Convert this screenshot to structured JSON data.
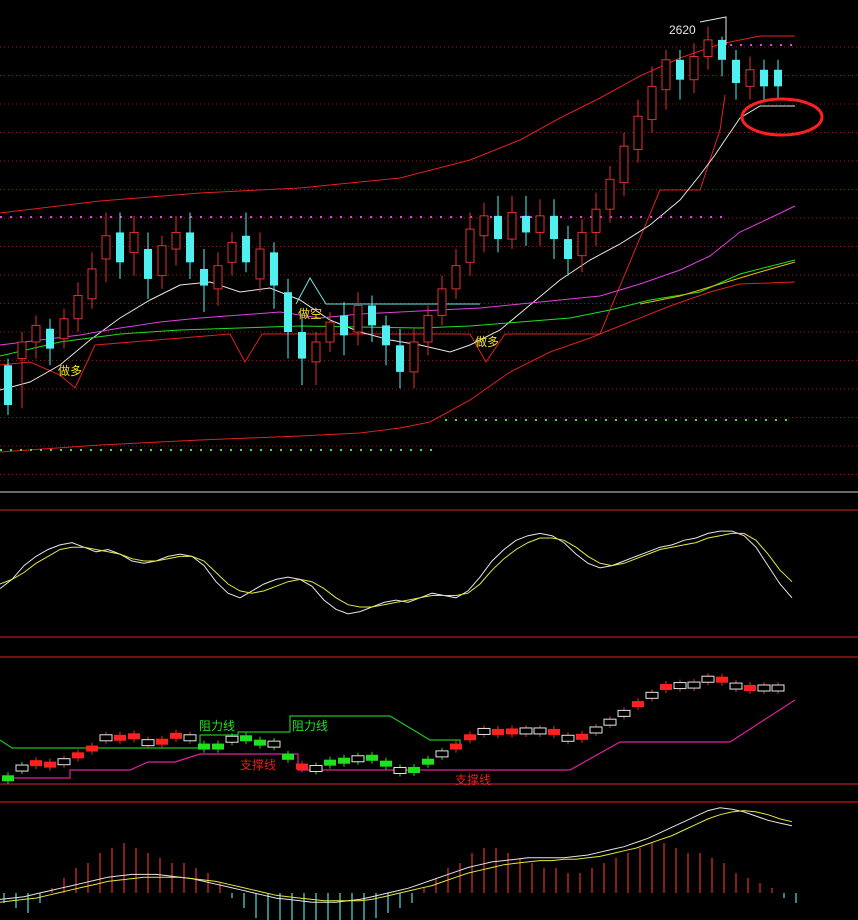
{
  "chart_data": [
    {
      "type": "candlestick",
      "panel": "main-price",
      "annotations": {
        "high_label": "2620",
        "buy_label": "做多",
        "short_label": "做空"
      },
      "candles": [
        {
          "o": 2392,
          "c": 2416,
          "h": 2420,
          "l": 2386,
          "up": false
        },
        {
          "o": 2420,
          "c": 2430,
          "h": 2436,
          "l": 2390,
          "up": true
        },
        {
          "o": 2430,
          "c": 2440,
          "h": 2446,
          "l": 2420,
          "up": true
        },
        {
          "o": 2438,
          "c": 2426,
          "h": 2444,
          "l": 2416,
          "up": false
        },
        {
          "o": 2432,
          "c": 2444,
          "h": 2450,
          "l": 2426,
          "up": true
        },
        {
          "o": 2444,
          "c": 2458,
          "h": 2466,
          "l": 2436,
          "up": true
        },
        {
          "o": 2456,
          "c": 2474,
          "h": 2484,
          "l": 2450,
          "up": true
        },
        {
          "o": 2480,
          "c": 2494,
          "h": 2508,
          "l": 2466,
          "up": true
        },
        {
          "o": 2496,
          "c": 2478,
          "h": 2508,
          "l": 2468,
          "up": false
        },
        {
          "o": 2484,
          "c": 2496,
          "h": 2506,
          "l": 2470,
          "up": true
        },
        {
          "o": 2486,
          "c": 2468,
          "h": 2496,
          "l": 2456,
          "up": false
        },
        {
          "o": 2470,
          "c": 2488,
          "h": 2494,
          "l": 2462,
          "up": true
        },
        {
          "o": 2486,
          "c": 2496,
          "h": 2506,
          "l": 2476,
          "up": true
        },
        {
          "o": 2496,
          "c": 2478,
          "h": 2508,
          "l": 2468,
          "up": false
        },
        {
          "o": 2474,
          "c": 2464,
          "h": 2486,
          "l": 2448,
          "up": false
        },
        {
          "o": 2462,
          "c": 2476,
          "h": 2484,
          "l": 2452,
          "up": true
        },
        {
          "o": 2478,
          "c": 2490,
          "h": 2496,
          "l": 2470,
          "up": true
        },
        {
          "o": 2494,
          "c": 2478,
          "h": 2508,
          "l": 2472,
          "up": false
        },
        {
          "o": 2468,
          "c": 2486,
          "h": 2496,
          "l": 2460,
          "up": true
        },
        {
          "o": 2484,
          "c": 2464,
          "h": 2490,
          "l": 2450,
          "up": false
        },
        {
          "o": 2460,
          "c": 2436,
          "h": 2468,
          "l": 2420,
          "up": false
        },
        {
          "o": 2436,
          "c": 2420,
          "h": 2446,
          "l": 2404,
          "up": false
        },
        {
          "o": 2418,
          "c": 2430,
          "h": 2436,
          "l": 2404,
          "up": true
        },
        {
          "o": 2430,
          "c": 2442,
          "h": 2448,
          "l": 2424,
          "up": true
        },
        {
          "o": 2446,
          "c": 2434,
          "h": 2454,
          "l": 2422,
          "up": false
        },
        {
          "o": 2436,
          "c": 2452,
          "h": 2460,
          "l": 2428,
          "up": true
        },
        {
          "o": 2452,
          "c": 2440,
          "h": 2458,
          "l": 2430,
          "up": false
        },
        {
          "o": 2440,
          "c": 2428,
          "h": 2446,
          "l": 2416,
          "up": false
        },
        {
          "o": 2428,
          "c": 2412,
          "h": 2438,
          "l": 2402,
          "up": false
        },
        {
          "o": 2412,
          "c": 2430,
          "h": 2438,
          "l": 2402,
          "up": true
        },
        {
          "o": 2430,
          "c": 2446,
          "h": 2452,
          "l": 2422,
          "up": true
        },
        {
          "o": 2446,
          "c": 2462,
          "h": 2470,
          "l": 2440,
          "up": true
        },
        {
          "o": 2462,
          "c": 2476,
          "h": 2486,
          "l": 2456,
          "up": true
        },
        {
          "o": 2478,
          "c": 2498,
          "h": 2508,
          "l": 2470,
          "up": true
        },
        {
          "o": 2494,
          "c": 2506,
          "h": 2514,
          "l": 2484,
          "up": true
        },
        {
          "o": 2506,
          "c": 2492,
          "h": 2518,
          "l": 2484,
          "up": false
        },
        {
          "o": 2492,
          "c": 2508,
          "h": 2518,
          "l": 2486,
          "up": true
        },
        {
          "o": 2506,
          "c": 2496,
          "h": 2518,
          "l": 2488,
          "up": false
        },
        {
          "o": 2496,
          "c": 2506,
          "h": 2516,
          "l": 2488,
          "up": true
        },
        {
          "o": 2506,
          "c": 2492,
          "h": 2516,
          "l": 2480,
          "up": false
        },
        {
          "o": 2492,
          "c": 2480,
          "h": 2500,
          "l": 2470,
          "up": false
        },
        {
          "o": 2482,
          "c": 2496,
          "h": 2504,
          "l": 2472,
          "up": true
        },
        {
          "o": 2496,
          "c": 2510,
          "h": 2520,
          "l": 2488,
          "up": true
        },
        {
          "o": 2510,
          "c": 2528,
          "h": 2536,
          "l": 2502,
          "up": true
        },
        {
          "o": 2526,
          "c": 2548,
          "h": 2556,
          "l": 2518,
          "up": true
        },
        {
          "o": 2546,
          "c": 2566,
          "h": 2576,
          "l": 2538,
          "up": true
        },
        {
          "o": 2564,
          "c": 2584,
          "h": 2596,
          "l": 2556,
          "up": true
        },
        {
          "o": 2582,
          "c": 2600,
          "h": 2606,
          "l": 2570,
          "up": true
        },
        {
          "o": 2600,
          "c": 2588,
          "h": 2606,
          "l": 2576,
          "up": false
        },
        {
          "o": 2588,
          "c": 2602,
          "h": 2610,
          "l": 2580,
          "up": true
        },
        {
          "o": 2602,
          "c": 2612,
          "h": 2620,
          "l": 2594,
          "up": true
        },
        {
          "o": 2612,
          "c": 2600,
          "h": 2614,
          "l": 2590,
          "up": false
        },
        {
          "o": 2600,
          "c": 2586,
          "h": 2606,
          "l": 2576,
          "up": false
        },
        {
          "o": 2584,
          "c": 2594,
          "h": 2602,
          "l": 2576,
          "up": true
        },
        {
          "o": 2594,
          "c": 2584,
          "h": 2600,
          "l": 2576,
          "up": false
        },
        {
          "o": 2584,
          "c": 2594,
          "h": 2600,
          "l": 2576,
          "up": false
        }
      ]
    },
    {
      "type": "line",
      "panel": "kdj-oscillator",
      "series": [
        {
          "values": [
            36,
            44,
            56,
            64,
            70,
            74,
            76,
            72,
            68,
            70,
            66,
            60,
            58,
            60,
            64,
            66,
            64,
            56,
            42,
            32,
            28,
            34,
            40,
            44,
            46,
            44,
            38,
            26,
            18,
            14,
            16,
            20,
            24,
            26,
            24,
            28,
            32,
            30,
            28,
            34,
            46,
            60,
            70,
            78,
            82,
            84,
            82,
            76,
            66,
            58,
            54,
            56,
            60,
            64,
            68,
            72,
            74,
            78,
            80,
            84,
            86,
            86,
            82,
            72,
            56,
            40,
            28
          ]
        },
        {
          "values": [
            40,
            44,
            50,
            58,
            64,
            70,
            72,
            72,
            70,
            68,
            66,
            62,
            60,
            60,
            62,
            64,
            64,
            60,
            50,
            40,
            34,
            32,
            34,
            38,
            42,
            44,
            42,
            36,
            28,
            22,
            20,
            20,
            22,
            24,
            26,
            28,
            30,
            30,
            30,
            32,
            40,
            52,
            62,
            70,
            76,
            80,
            80,
            78,
            72,
            64,
            58,
            56,
            58,
            62,
            66,
            70,
            72,
            74,
            76,
            80,
            82,
            84,
            84,
            78,
            66,
            52,
            42
          ]
        }
      ]
    },
    {
      "type": "candlestick",
      "panel": "support-resistance",
      "annotations": {
        "resistance_1": "阻力线",
        "resistance_2": "阻力线",
        "support_1": "支撑线",
        "support_2": "支撑线"
      }
    },
    {
      "type": "bar-line",
      "panel": "macd",
      "bars": [
        -2,
        -3,
        -4,
        -2,
        1,
        3,
        5,
        6,
        8,
        9,
        10,
        9,
        8,
        7,
        6,
        6,
        5,
        4,
        2,
        -1,
        -3,
        -5,
        -6,
        -7,
        -8,
        -9,
        -9,
        -8,
        -7,
        -6,
        -6,
        -5,
        -4,
        -3,
        -2,
        1,
        3,
        5,
        6,
        8,
        9,
        9,
        8,
        7,
        6,
        5,
        5,
        4,
        4,
        5,
        6,
        7,
        8,
        9,
        10,
        10,
        9,
        8,
        8,
        7,
        6,
        4,
        3,
        2,
        1,
        -1,
        -2
      ],
      "series": [
        {
          "values": [
            -8,
            -7,
            -6,
            -4,
            -2,
            0,
            2,
            4,
            6,
            8,
            9,
            10,
            10,
            10,
            9,
            8,
            7,
            5,
            3,
            1,
            -1,
            -3,
            -5,
            -7,
            -8,
            -9,
            -10,
            -10,
            -10,
            -9,
            -8,
            -6,
            -4,
            -2,
            0,
            3,
            6,
            9,
            12,
            15,
            17,
            19,
            20,
            21,
            22,
            22,
            22,
            22,
            23,
            24,
            26,
            28,
            30,
            33,
            36,
            40,
            44,
            48,
            52,
            56,
            58,
            57,
            55,
            52,
            49,
            47,
            45
          ]
        },
        {
          "values": [
            -10,
            -9,
            -8,
            -7,
            -5,
            -3,
            -1,
            1,
            3,
            5,
            6,
            7,
            8,
            8,
            8,
            8,
            7,
            6,
            5,
            3,
            1,
            -1,
            -3,
            -5,
            -6,
            -7,
            -8,
            -9,
            -9,
            -9,
            -9,
            -8,
            -6,
            -4,
            -2,
            0,
            2,
            5,
            8,
            11,
            13,
            15,
            17,
            18,
            19,
            20,
            20,
            21,
            21,
            22,
            23,
            25,
            27,
            29,
            32,
            35,
            38,
            42,
            46,
            50,
            53,
            55,
            56,
            55,
            53,
            50,
            48
          ]
        }
      ]
    }
  ]
}
